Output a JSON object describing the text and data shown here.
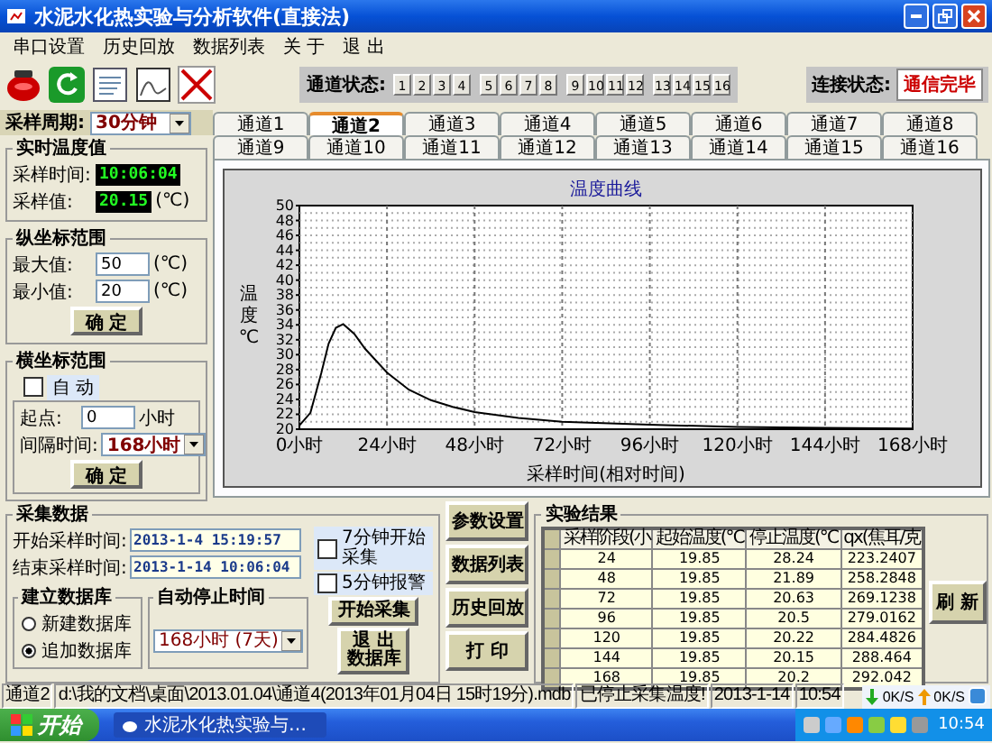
{
  "window": {
    "title": "水泥水化热实验与分析软件(直接法)"
  },
  "menu": [
    "串口设置",
    "历史回放",
    "数据列表",
    "关 于",
    "退 出"
  ],
  "channel_status": {
    "label": "通道状态:",
    "channels": [
      "1",
      "2",
      "3",
      "4",
      "5",
      "6",
      "7",
      "8",
      "9",
      "10",
      "11",
      "12",
      "13",
      "14",
      "15",
      "16"
    ]
  },
  "connection": {
    "label": "连接状态:",
    "value": "通信完毕"
  },
  "sampling_period": {
    "label": "采样周期:",
    "value": "30分钟"
  },
  "realtime": {
    "title": "实时温度值",
    "time_label": "采样时间:",
    "time": "10:06:04",
    "value_label": "采样值:",
    "value": "20.15",
    "unit": "(℃)"
  },
  "y_range": {
    "title": "纵坐标范围",
    "max_label": "最大值:",
    "max": "50",
    "max_unit": "(℃)",
    "min_label": "最小值:",
    "min": "20",
    "min_unit": "(℃)",
    "button": "确 定"
  },
  "x_range": {
    "title": "横坐标范围",
    "auto": {
      "label": "自 动",
      "checked": false
    },
    "start_label": "起点:",
    "start": "0",
    "start_unit": "小时",
    "interval_label": "间隔时间:",
    "interval": "168小时",
    "button": "确 定"
  },
  "tabs": [
    {
      "label": "通道1",
      "selected": false
    },
    {
      "label": "通道2",
      "selected": true
    },
    {
      "label": "通道3",
      "selected": false
    },
    {
      "label": "通道4",
      "selected": false
    },
    {
      "label": "通道5",
      "selected": false
    },
    {
      "label": "通道6",
      "selected": false
    },
    {
      "label": "通道7",
      "selected": false
    },
    {
      "label": "通道8",
      "selected": false
    },
    {
      "label": "通道9",
      "selected": false
    },
    {
      "label": "通道10",
      "selected": false
    },
    {
      "label": "通道11",
      "selected": false
    },
    {
      "label": "通道12",
      "selected": false
    },
    {
      "label": "通道13",
      "selected": false
    },
    {
      "label": "通道14",
      "selected": false
    },
    {
      "label": "通道15",
      "selected": false
    },
    {
      "label": "通道16",
      "selected": false
    }
  ],
  "chart": {
    "chart_data": {
      "type": "line",
      "title": "温度曲线",
      "xlabel": "采样时间(相对时间)",
      "ylabel": "温度℃",
      "x": [
        0,
        3,
        6,
        8,
        10,
        12,
        15,
        18,
        24,
        30,
        36,
        42,
        48,
        60,
        72,
        96,
        120,
        144,
        168
      ],
      "series": [
        {
          "color": "#000000",
          "values": [
            20.5,
            22.2,
            27.5,
            31.5,
            33.6,
            34.1,
            32.8,
            30.8,
            27.6,
            25.3,
            23.9,
            23,
            22.3,
            21.5,
            21,
            20.6,
            20.3,
            20.2,
            20.1
          ]
        }
      ],
      "xlim": [
        0,
        168
      ],
      "ylim": [
        20,
        50
      ],
      "grid": true,
      "xticks": [
        {
          "value": 0,
          "label": "0小时"
        },
        {
          "value": 24,
          "label": "24小时"
        },
        {
          "value": 48,
          "label": "48小时"
        },
        {
          "value": 72,
          "label": "72小时"
        },
        {
          "value": 96,
          "label": "96小时"
        },
        {
          "value": 120,
          "label": "120小时"
        },
        {
          "value": 144,
          "label": "144小时"
        },
        {
          "value": 168,
          "label": "168小时"
        }
      ],
      "yticks": [
        20,
        22,
        24,
        26,
        28,
        30,
        32,
        34,
        36,
        38,
        40,
        42,
        44,
        46,
        48,
        50
      ]
    }
  },
  "collect": {
    "title": "采集数据",
    "start_label": "开始采样时间:",
    "start": "2013-1-4 15:19:57",
    "end_label": "结束采样时间:",
    "end": "2013-1-14 10:06:04",
    "database": {
      "title": "建立数据库",
      "options": [
        {
          "label": "新建数据库",
          "selected": false
        },
        {
          "label": "追加数据库",
          "selected": true
        }
      ]
    },
    "auto_stop": {
      "title": "自动停止时间",
      "value": "168小时 (7天)"
    },
    "options": [
      {
        "label": "7分钟开始采集",
        "checked": false
      },
      {
        "label": "5分钟报警",
        "checked": false
      }
    ],
    "buttons": [
      {
        "lines": [
          "开始采集"
        ]
      },
      {
        "lines": [
          "退 出",
          "数据库"
        ]
      }
    ]
  },
  "actions": [
    "参数设置",
    "数据列表",
    "历史回放",
    "打 印"
  ],
  "results": {
    "title": "实验结果",
    "columns": [
      "采样阶段(小",
      "起始温度(℃",
      "停止温度(℃",
      "qx(焦耳/克"
    ],
    "rows": [
      [
        "24",
        "19.85",
        "28.24",
        "223.2407"
      ],
      [
        "48",
        "19.85",
        "21.89",
        "258.2848"
      ],
      [
        "72",
        "19.85",
        "20.63",
        "269.1238"
      ],
      [
        "96",
        "19.85",
        "20.5",
        "279.0162"
      ],
      [
        "120",
        "19.85",
        "20.22",
        "284.4826"
      ],
      [
        "144",
        "19.85",
        "20.15",
        "288.464"
      ],
      [
        "168",
        "19.85",
        "20.2",
        "292.042"
      ]
    ],
    "refresh": "刷 新"
  },
  "status_bar": [
    "通道2",
    "d:\\我的文档\\桌面\\2013.01.04\\通道4(2013年01月04日 15时19分).mdb",
    "已停止采集温度!",
    "2013-1-14",
    "10:54"
  ],
  "network": {
    "down": "0K/S",
    "up": "0K/S"
  },
  "taskbar": {
    "start": "开始",
    "task": "水泥水化热实验与…",
    "clock": "10:54"
  }
}
